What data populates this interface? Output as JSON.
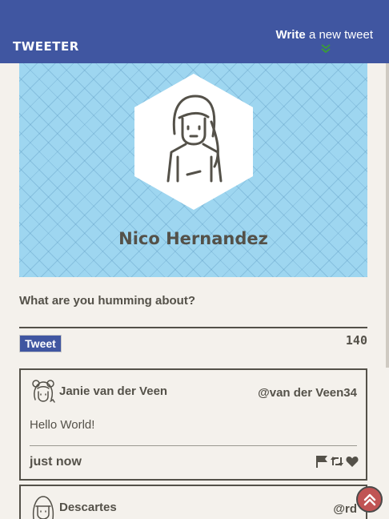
{
  "nav": {
    "brand": "TWEETER",
    "compose_bold": "Write",
    "compose_rest": " a new tweet",
    "accent_arrow_color": "#2e7d32"
  },
  "profile": {
    "name": "Nico Hernandez",
    "banner_color": "#9ed6f0"
  },
  "compose": {
    "prompt": "What are you humming about?",
    "button_label": "Tweet",
    "counter": "140"
  },
  "tweets": [
    {
      "name": "Janie van der Veen",
      "handle": "@van der Veen34",
      "text": "Hello World!",
      "time": "just now",
      "actions": [
        "flag-icon",
        "retweet-icon",
        "heart-icon"
      ]
    },
    {
      "name": "Descartes",
      "handle": "@rd"
    }
  ],
  "colors": {
    "nav": "#4056a1",
    "background": "#f4f1ec",
    "text": "#545149",
    "scroll_button": "#c05454"
  }
}
